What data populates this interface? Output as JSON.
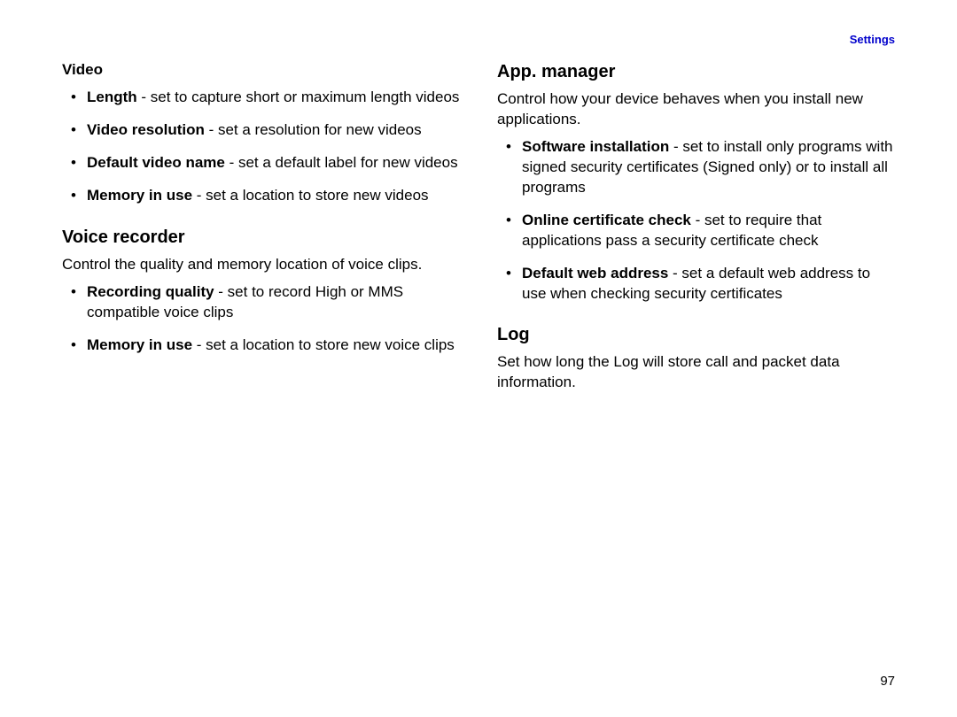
{
  "header": {
    "label": "Settings"
  },
  "page_number": "97",
  "left": {
    "video": {
      "heading": "Video",
      "items": [
        {
          "term": "Length",
          "desc": " - set to capture short or maximum length videos"
        },
        {
          "term": "Video resolution",
          "desc": " - set a resolution for new videos"
        },
        {
          "term": "Default video name",
          "desc": " - set a default label for new videos"
        },
        {
          "term": "Memory in use",
          "desc": " - set a location to store new videos"
        }
      ]
    },
    "voice": {
      "heading": "Voice recorder",
      "intro": "Control the quality and memory location of voice clips.",
      "items": [
        {
          "term": "Recording quality",
          "desc": " - set to record High or MMS compatible voice clips"
        },
        {
          "term": "Memory in use",
          "desc": " - set a location to store new voice clips"
        }
      ]
    }
  },
  "right": {
    "appmgr": {
      "heading": "App. manager",
      "intro": "Control how your device behaves when you install new applications.",
      "items": [
        {
          "term": "Software installation",
          "desc": " - set to install only programs with signed security certificates (Signed only) or to install all programs"
        },
        {
          "term": "Online certificate check",
          "desc": " - set to require that applications pass a security certificate check"
        },
        {
          "term": "Default web address",
          "desc": " - set a default web address to use when checking security certificates"
        }
      ]
    },
    "log": {
      "heading": "Log",
      "intro": "Set how long the Log will store call and packet data information."
    }
  }
}
